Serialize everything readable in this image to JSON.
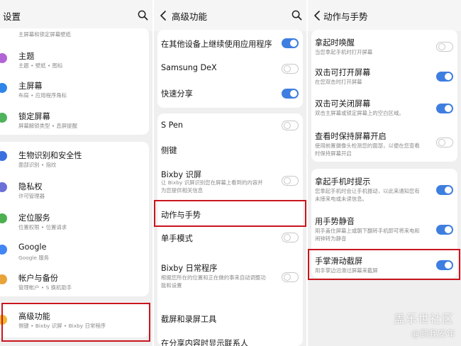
{
  "colors": {
    "toggle_on": "#3e7ee0",
    "highlight": "#c9151e",
    "card_bg": "#ffffff",
    "panel_bg": "#efefef"
  },
  "panel1": {
    "title": "设置",
    "partial_sub": "主屏幕和锁定屏幕壁纸",
    "items": [
      {
        "label": "主题",
        "sub": "主题 • 壁纸 • 图标",
        "icon": "theme-icon"
      },
      {
        "label": "主屏幕",
        "sub": "布局 • 应用程序角标",
        "icon": "home-screen-icon"
      },
      {
        "label": "锁定屏幕",
        "sub": "屏幕解锁类型 • 息屏提醒",
        "icon": "lock-icon"
      },
      {
        "label": "生物识别和安全性",
        "sub": "面部识别 • 指纹",
        "icon": "shield-icon"
      },
      {
        "label": "隐私权",
        "sub": "许可管理器",
        "icon": "privacy-icon"
      },
      {
        "label": "定位服务",
        "sub": "位置权限 • 位置请求",
        "icon": "location-icon"
      },
      {
        "label": "Google",
        "sub": "Google 服务",
        "icon": "google-icon"
      },
      {
        "label": "帐户与备份",
        "sub": "管理帐户 • S 换机助手",
        "icon": "account-icon"
      },
      {
        "label": "高级功能",
        "sub": "侧键 • Bixby 识屏 • Bixby 日常程序",
        "icon": "advanced-features-icon"
      }
    ]
  },
  "panel2": {
    "title": "高级功能",
    "items": [
      {
        "label": "在其他设备上继续使用应用程序",
        "toggle": true
      },
      {
        "label": "Samsung DeX",
        "toggle": false
      },
      {
        "label": "快速分享",
        "toggle": true
      },
      {
        "label": "S Pen",
        "toggle": false
      },
      {
        "label": "侧键"
      },
      {
        "label": "Bixby 识屏",
        "sub": "让 Bixby 识屏识别您在屏幕上看到的内容并为您提供相关信息",
        "toggle": false
      },
      {
        "label": "动作与手势"
      },
      {
        "label": "单手模式",
        "toggle": false
      },
      {
        "label": "Bixby 日常程序",
        "sub": "根据您所在的位置和正在做的事来自动调整功能和设置",
        "toggle": false
      },
      {
        "label": "截屏和录屏工具"
      },
      {
        "label": "在分享内容时显示联系人"
      }
    ]
  },
  "panel3": {
    "title": "动作与手势",
    "items": [
      {
        "label": "拿起时唤醒",
        "sub": "当您拿起手机时打开屏幕",
        "toggle": false
      },
      {
        "label": "双击可打开屏幕",
        "sub": "在您双击时打开屏幕",
        "toggle": true
      },
      {
        "label": "双击可关闭屏幕",
        "sub": "双击主屏幕或锁定屏幕上的空白区域。",
        "toggle": true
      },
      {
        "label": "查看时保持屏幕开启",
        "sub": "使用前置摄像头检测您的面部，以便在您查看时保持屏幕开启",
        "toggle": false
      },
      {
        "label": "拿起手机时提示",
        "sub": "您拿起手机时会让手机振动，以此来通知您有未接来电或未读信息。",
        "toggle": true
      },
      {
        "label": "用手势静音",
        "sub": "用手盖住屏幕上或朝下翻转手机即可将来电和闹钟转为静音",
        "toggle": true
      },
      {
        "label": "手掌滑动截屏",
        "sub": "用手掌边沿滑过屏幕来截屏",
        "toggle": true
      }
    ]
  },
  "watermark": {
    "line1": "盖乐世社区",
    "line2": "@顾我安年"
  }
}
